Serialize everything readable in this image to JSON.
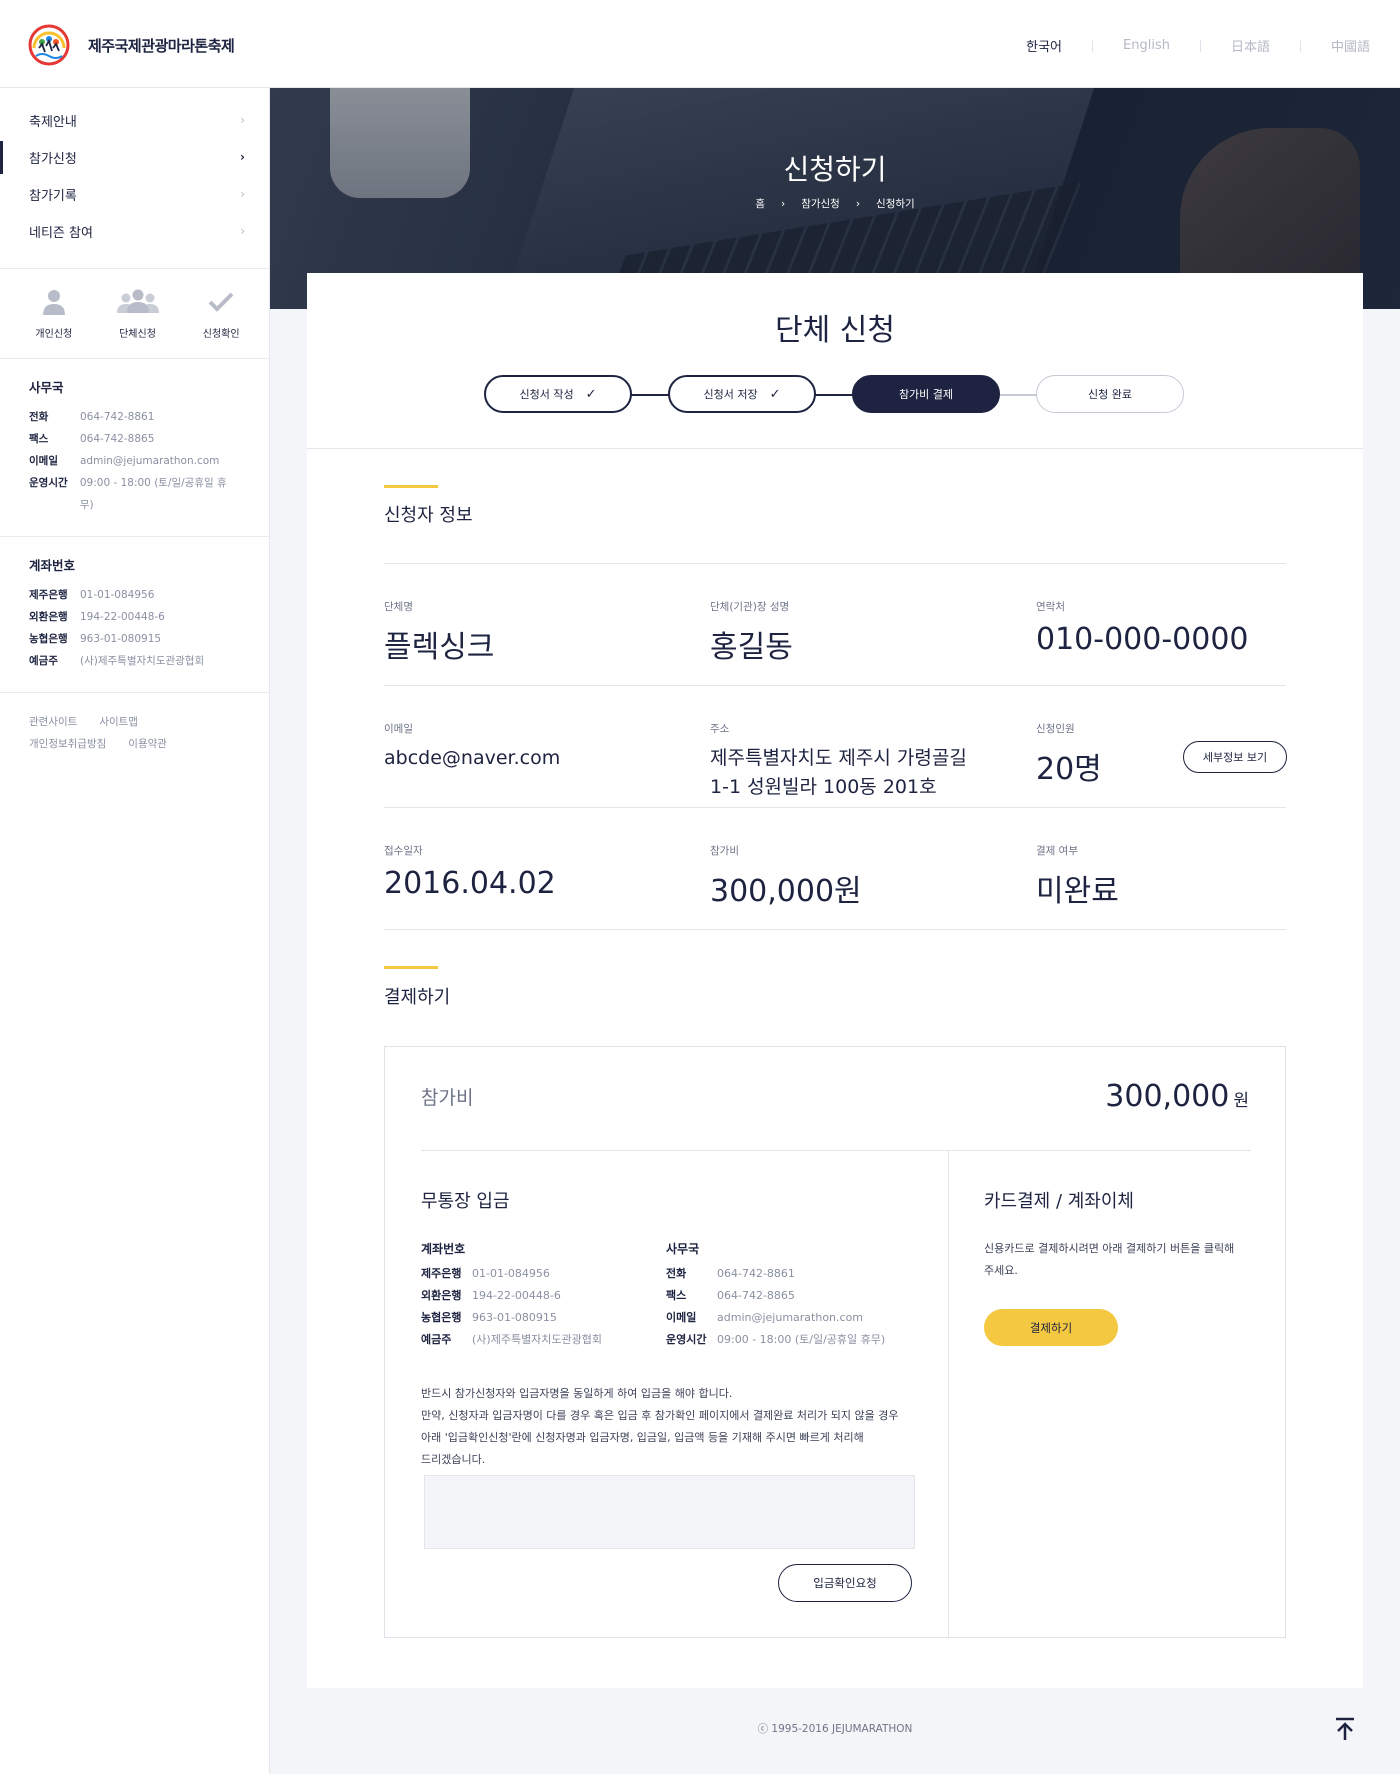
{
  "header": {
    "logo_text": "제주국제관광마라톤축제",
    "languages": [
      {
        "label": "한국어",
        "active": true
      },
      {
        "label": "English",
        "active": false
      },
      {
        "label": "日本語",
        "active": false
      },
      {
        "label": "中國語",
        "active": false
      }
    ]
  },
  "sidebar": {
    "nav": [
      {
        "label": "축제안내"
      },
      {
        "label": "참가신청"
      },
      {
        "label": "참가기록"
      },
      {
        "label": "네티즌 참여"
      }
    ],
    "quick": [
      {
        "label": "개인신청",
        "icon": "person-icon"
      },
      {
        "label": "단체신청",
        "icon": "group-icon"
      },
      {
        "label": "신청확인",
        "icon": "check-icon"
      }
    ],
    "office": {
      "title": "사무국",
      "rows": [
        {
          "k": "전화",
          "v": "064-742-8861"
        },
        {
          "k": "팩스",
          "v": "064-742-8865"
        },
        {
          "k": "이메일",
          "v": "admin@jejumarathon.com"
        },
        {
          "k": "운영시간",
          "v": "09:00 - 18:00 (토/일/공휴일 휴무)"
        }
      ]
    },
    "account": {
      "title": "계좌번호",
      "rows": [
        {
          "k": "제주은행",
          "v": "01-01-084956"
        },
        {
          "k": "외환은행",
          "v": "194-22-00448-6"
        },
        {
          "k": "농협은행",
          "v": "963-01-080915"
        },
        {
          "k": "예금주",
          "v": "(사)제주특별자치도관광협회"
        }
      ]
    },
    "links": [
      "관련사이트",
      "사이트맵",
      "개인정보취급방침",
      "이용약관"
    ]
  },
  "hero": {
    "title": "신청하기",
    "breadcrumb": [
      "홈",
      "›",
      "참가신청",
      "›",
      "신청하기"
    ]
  },
  "card": {
    "title": "단체 신청",
    "steps": [
      {
        "label": "신청서 작성",
        "state": "done"
      },
      {
        "label": "신청서 저장",
        "state": "done"
      },
      {
        "label": "참가비 결제",
        "state": "current"
      },
      {
        "label": "신청 완료",
        "state": "todo"
      }
    ],
    "applicant": {
      "section_title": "신청자 정보",
      "group_name_label": "단체명",
      "group_name": "플렉싱크",
      "leader_label": "단체(기관)장 성명",
      "leader": "홍길동",
      "contact_label": "연락처",
      "contact": "010-000-0000",
      "email_label": "이메일",
      "email": "abcde@naver.com",
      "address_label": "주소",
      "address_line1": "제주특별자치도 제주시 가령골길",
      "address_line2": "1-1 성원빌라 100동 201호",
      "members_label": "신청인원",
      "members": "20명",
      "detail_button": "세부정보 보기",
      "date_label": "접수일자",
      "date": "2016.04.02",
      "fee_label": "참가비",
      "fee": "300,000원",
      "paid_label": "결제 여부",
      "paid": "미완료"
    },
    "payment": {
      "section_title": "결제하기",
      "fee_label": "참가비",
      "fee_amount": "300,000",
      "fee_unit": "원",
      "bank_title": "무통장 입금",
      "account_title": "계좌번호",
      "accounts": [
        {
          "k": "제주은행",
          "v": "01-01-084956"
        },
        {
          "k": "외환은행",
          "v": "194-22-00448-6"
        },
        {
          "k": "농협은행",
          "v": "963-01-080915"
        },
        {
          "k": "예금주",
          "v": "(사)제주특별자치도관광협회"
        }
      ],
      "office_title": "사무국",
      "office": [
        {
          "k": "전화",
          "v": "064-742-8861"
        },
        {
          "k": "팩스",
          "v": "064-742-8865"
        },
        {
          "k": "이메일",
          "v": "admin@jejumarathon.com"
        },
        {
          "k": "운영시간",
          "v": "09:00 - 18:00 (토/일/공휴일 휴무)"
        }
      ],
      "notice_lines": [
        "반드시 참가신청자와 입금자명을 동일하게 하여 입금을 해야 합니다.",
        "만약, 신청자과 입금자명이 다를 경우 혹은 입금 후 참가확인 페이지에서 결제완료 처리가 되지 않을 경우",
        "아래 '입금확인신청'란에 신청자명과 입금자명, 입금일, 입금액 등을 기재해 주시면 빠르게 처리해",
        "드리겠습니다."
      ],
      "confirm_button": "입금확인요청",
      "card_title": "카드결제 / 계좌이체",
      "card_desc": "신용카드로 결제하시려면 아래 결제하기 버튼을 클릭해 주세요.",
      "pay_button": "결제하기"
    }
  },
  "footer": {
    "copyright": "ⓒ 1995-2016 JEJUMARATHON"
  },
  "colors": {
    "navy": "#1d2340",
    "accent": "#f5c842"
  }
}
